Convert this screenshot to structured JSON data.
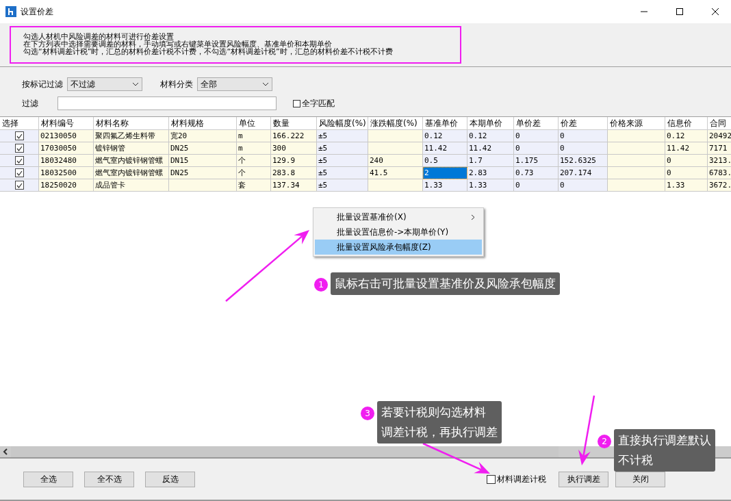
{
  "window": {
    "title": "设置价差"
  },
  "notice": [
    "勾选人材机中风险调差的材料可进行价差设置",
    "在下方列表中选择需要调差的材料，手动填写或右键菜单设置风险幅度、基准单价和本期单价",
    "勾选“材料调差计税”时，汇总的材料价差计税不计费，不勾选“材料调差计税”时，汇总的材料价差不计税不计费"
  ],
  "filters": {
    "mark_filter": {
      "label": "按标记过滤",
      "value": "不过滤"
    },
    "category": {
      "label": "材料分类",
      "value": "全部"
    },
    "text_filter": {
      "label": "过滤"
    },
    "whole_word": {
      "label": "全字匹配",
      "checked": false
    }
  },
  "table": {
    "select_column": "选择",
    "columns": [
      "材料编号",
      "材料名称",
      "材料规格",
      "单位",
      "数量",
      "风险幅度(%)",
      "涨跌幅度(%)",
      "基准单价",
      "本期单价",
      "单价差",
      "价差",
      "价格来源",
      "信息价",
      "合同"
    ],
    "rows": [
      {
        "checked": true,
        "cells": [
          {
            "text": "02130050",
            "selected": false
          },
          {
            "text": "聚四氟乙烯生料带",
            "selected": false
          },
          {
            "text": "宽20",
            "selected": false
          },
          {
            "text": "m",
            "selected": false
          },
          {
            "text": "166.222",
            "selected": false
          },
          {
            "text": "±5",
            "selected": false
          },
          {
            "text": "",
            "selected": false
          },
          {
            "text": "0.12",
            "selected": false
          },
          {
            "text": "0.12",
            "selected": false
          },
          {
            "text": "0",
            "selected": false
          },
          {
            "text": "0",
            "selected": false
          },
          {
            "text": "",
            "selected": false
          },
          {
            "text": "0.12",
            "selected": false
          },
          {
            "text": "20492",
            "selected": false
          }
        ]
      },
      {
        "checked": true,
        "cells": [
          {
            "text": "17030050",
            "selected": false
          },
          {
            "text": "镀锌钢管",
            "selected": false
          },
          {
            "text": "DN25",
            "selected": false
          },
          {
            "text": "m",
            "selected": false
          },
          {
            "text": "300",
            "selected": false
          },
          {
            "text": "±5",
            "selected": false
          },
          {
            "text": "",
            "selected": false
          },
          {
            "text": "11.42",
            "selected": false
          },
          {
            "text": "11.42",
            "selected": false
          },
          {
            "text": "0",
            "selected": false
          },
          {
            "text": "0",
            "selected": false
          },
          {
            "text": "",
            "selected": false
          },
          {
            "text": "11.42",
            "selected": false
          },
          {
            "text": "7171",
            "selected": false
          }
        ]
      },
      {
        "checked": true,
        "cells": [
          {
            "text": "18032480",
            "selected": false
          },
          {
            "text": "燃气室内镀锌钢管螺",
            "selected": false
          },
          {
            "text": "DN15",
            "selected": false
          },
          {
            "text": "个",
            "selected": false
          },
          {
            "text": "129.9",
            "selected": false
          },
          {
            "text": "±5",
            "selected": false
          },
          {
            "text": "240",
            "selected": false
          },
          {
            "text": "0.5",
            "selected": false
          },
          {
            "text": "1.7",
            "selected": false
          },
          {
            "text": "1.175",
            "selected": false
          },
          {
            "text": "152.6325",
            "selected": false
          },
          {
            "text": "",
            "selected": false
          },
          {
            "text": "0",
            "selected": false
          },
          {
            "text": "3213.",
            "selected": false
          }
        ]
      },
      {
        "checked": true,
        "cells": [
          {
            "text": "18032500",
            "selected": false
          },
          {
            "text": "燃气室内镀锌钢管螺",
            "selected": false
          },
          {
            "text": "DN25",
            "selected": false
          },
          {
            "text": "个",
            "selected": false
          },
          {
            "text": "283.8",
            "selected": false
          },
          {
            "text": "±5",
            "selected": false
          },
          {
            "text": "41.5",
            "selected": false
          },
          {
            "text": "2",
            "selected": true
          },
          {
            "text": "2.83",
            "selected": false
          },
          {
            "text": "0.73",
            "selected": false
          },
          {
            "text": "207.174",
            "selected": false
          },
          {
            "text": "",
            "selected": false
          },
          {
            "text": "0",
            "selected": false
          },
          {
            "text": "6783.",
            "selected": false
          }
        ]
      },
      {
        "checked": true,
        "cells": [
          {
            "text": "18250020",
            "selected": false
          },
          {
            "text": "成品管卡",
            "selected": false
          },
          {
            "text": "",
            "selected": false
          },
          {
            "text": "套",
            "selected": false
          },
          {
            "text": "137.34",
            "selected": false
          },
          {
            "text": "±5",
            "selected": false
          },
          {
            "text": "",
            "selected": false
          },
          {
            "text": "1.33",
            "selected": false
          },
          {
            "text": "1.33",
            "selected": false
          },
          {
            "text": "0",
            "selected": false
          },
          {
            "text": "0",
            "selected": false
          },
          {
            "text": "",
            "selected": false
          },
          {
            "text": "1.33",
            "selected": false
          },
          {
            "text": "3672.",
            "selected": false
          }
        ]
      }
    ]
  },
  "context_menu": [
    {
      "label": "批量设置基准价(X)",
      "submenu": true,
      "selected": false
    },
    {
      "label": "批量设置信息价->本期单价(Y)",
      "submenu": false,
      "selected": false
    },
    {
      "label": "批量设置风险承包幅度(Z)",
      "submenu": false,
      "selected": true
    }
  ],
  "callouts": [
    {
      "number": "1",
      "lines": [
        "鼠标右击可批量设置基准价及风险承包幅度"
      ]
    },
    {
      "number": "3",
      "lines": [
        "若要计税则勾选材料",
        "调差计税，再执行调差"
      ]
    },
    {
      "number": "2",
      "lines": [
        "直接执行调差默认",
        "不计税"
      ]
    }
  ],
  "bottom": {
    "left_buttons": [
      "全选",
      "全不选",
      "反选"
    ],
    "tax_checkbox": {
      "label": "材料调差计税",
      "checked": false
    },
    "right_buttons": [
      "执行调差",
      "关闭"
    ]
  }
}
